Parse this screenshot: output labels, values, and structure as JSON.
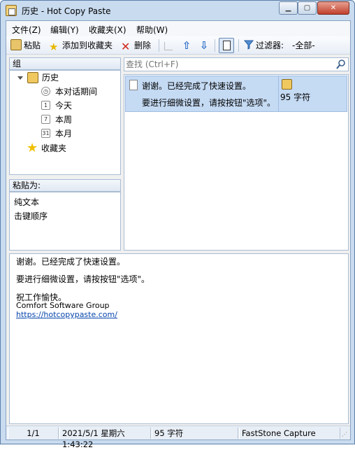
{
  "window": {
    "title": "历史 - Hot Copy Paste"
  },
  "menu": [
    {
      "label": "文件(Z)"
    },
    {
      "label": "编辑(Y)"
    },
    {
      "label": "收藏夹(X)"
    },
    {
      "label": "帮助(W)"
    }
  ],
  "toolbar": {
    "paste_label": "粘贴",
    "add_favorite_label": "添加到收藏夹",
    "delete_label": "删除",
    "filter_label": "过滤器:",
    "filter_value": "-全部-"
  },
  "groups": {
    "header": "组",
    "history": "历史",
    "this_session": "本对话期间",
    "today": "今天",
    "today_icon": "1",
    "this_week": "本周",
    "this_week_icon": "7",
    "this_month": "本月",
    "this_month_icon": "31",
    "favorites": "收藏夹"
  },
  "paste_as": {
    "header": "粘贴为:",
    "items": [
      "纯文本",
      "击键顺序"
    ]
  },
  "search": {
    "placeholder": "查找 (Ctrl+F)"
  },
  "clip": {
    "line1": "谢谢。已经完成了快速设置。",
    "line2": "要进行细微设置，请按按钮\"选项\"。",
    "size": "95 字符"
  },
  "preview": {
    "line1": "谢谢。已经完成了快速设置。",
    "line2": "要进行细微设置，请按按钮\"选项\"。",
    "line3": "祝工作愉快。",
    "company": "Comfort Software Group",
    "url": "https://hotcopypaste.com/"
  },
  "status": {
    "page": "1/1",
    "datetime": "2021/5/1 星期六 1:43:22",
    "chars": "95 字符",
    "source": "FastStone Capture"
  },
  "colors": {
    "selection": "#c5daf3",
    "link": "#0645ad",
    "arrow": "#2f6ec9"
  }
}
